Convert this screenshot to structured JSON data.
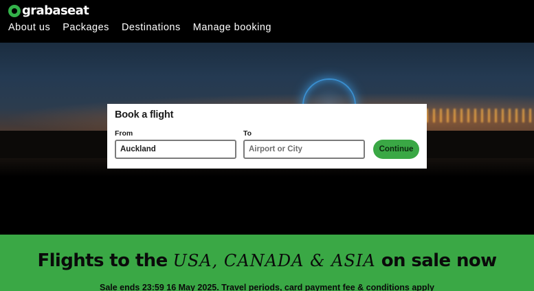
{
  "brand": {
    "name": "grabaseat",
    "accent": "#33b24a",
    "icon": "grabaseat-logo-mark"
  },
  "nav": {
    "items": [
      {
        "label": "About us"
      },
      {
        "label": "Packages"
      },
      {
        "label": "Destinations"
      },
      {
        "label": "Manage booking"
      }
    ]
  },
  "hero": {
    "image": "santa-monica-pier-ferris-wheel-at-dusk"
  },
  "booking": {
    "title": "Book a flight",
    "from_label": "From",
    "from_value": "Auckland",
    "to_label": "To",
    "to_placeholder": "Airport or City",
    "to_value": "",
    "continue_label": "Continue",
    "button_color": "#3aa845"
  },
  "promo": {
    "headline_start": "Flights to the",
    "headline_highlight": "USA, CANADA & ASIA",
    "headline_end": "on sale now",
    "subtext": "Sale ends 23:59 16 May 2025. Travel periods, card payment fee & conditions apply",
    "background": "#3aa845"
  }
}
